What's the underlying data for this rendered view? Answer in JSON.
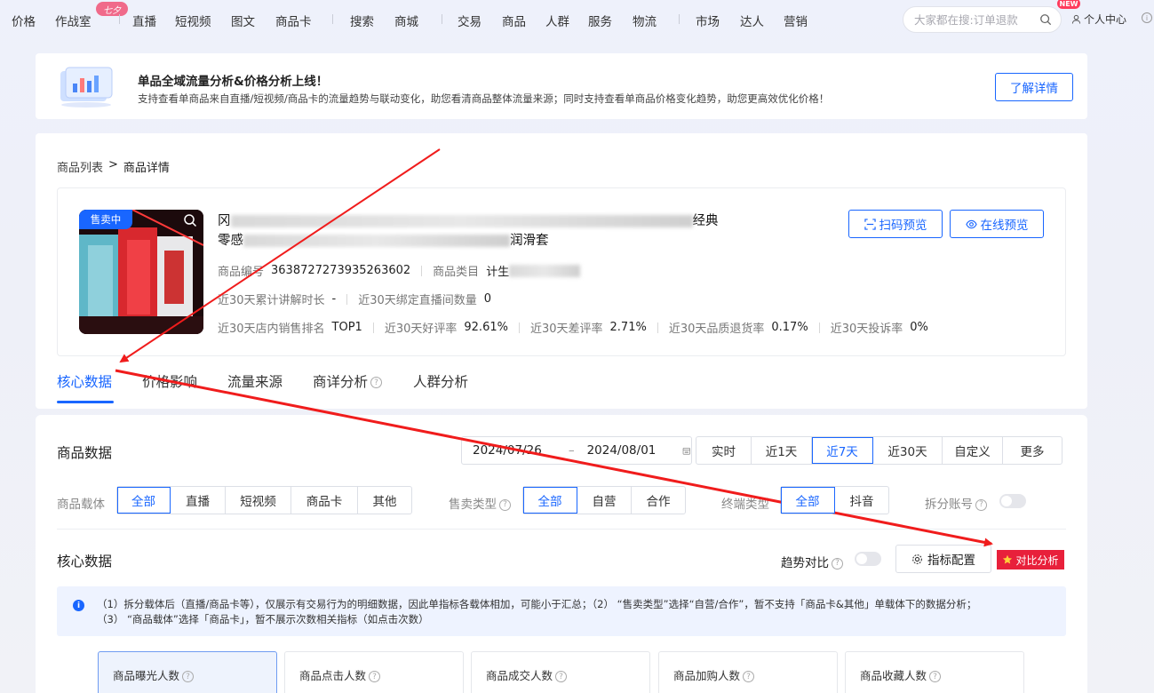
{
  "nav": {
    "items": [
      "价格",
      "作战室",
      "直播",
      "短视频",
      "图文",
      "商品卡",
      "搜索",
      "商城",
      "交易",
      "商品",
      "人群",
      "服务",
      "物流",
      "市场",
      "达人",
      "营销"
    ],
    "badge_7": "七夕",
    "search_placeholder": "大家都在搜:订单退款",
    "personal": "个人中心",
    "new_badge": "NEW"
  },
  "banner": {
    "title": "单品全域流量分析&价格分析上线！",
    "desc": "支持查看单商品来自直播/短视频/商品卡的流量趋势与联动变化，助您看清商品整体流量来源；同时支持查看单商品价格变化趋势，助您更高效优化价格！",
    "button": "了解详情"
  },
  "breadcrumb": {
    "list": "商品列表",
    "sep": ">",
    "current": "商品详情"
  },
  "product": {
    "status": "售卖中",
    "title_l1_start": "冈",
    "title_l1_end": "经典",
    "title_l2_start": "零感",
    "title_l2_end": "润滑套",
    "id_label": "商品编号",
    "id_value": "3638727273935263602",
    "category_label": "商品类目",
    "category_value": "计生",
    "explain_label": "近30天累计讲解时长",
    "explain_value": "-",
    "bind_label": "近30天绑定直播间数量",
    "bind_value": "0",
    "rank_label": "近30天店内销售排名",
    "rank_value": "TOP1",
    "good_label": "近30天好评率",
    "good_value": "92.61%",
    "bad_label": "近30天差评率",
    "bad_value": "2.71%",
    "refund_label": "近30天品质退货率",
    "refund_value": "0.17%",
    "complaint_label": "近30天投诉率",
    "complaint_value": "0%",
    "btn_scan": "扫码预览",
    "btn_online": "在线预览"
  },
  "tabs": [
    "核心数据",
    "价格影响",
    "流量来源",
    "商详分析",
    "人群分析"
  ],
  "goods_data": {
    "title": "商品数据",
    "date_start": "2024/07/26",
    "date_sep": "–",
    "date_end": "2024/08/01",
    "ranges": [
      "实时",
      "近1天",
      "近7天",
      "近30天",
      "自定义",
      "更多"
    ],
    "carrier_label": "商品载体",
    "carrier": [
      "全部",
      "直播",
      "短视频",
      "商品卡",
      "其他"
    ],
    "sale_label": "售卖类型",
    "sale": [
      "全部",
      "自营",
      "合作"
    ],
    "terminal_label": "终端类型",
    "terminal": [
      "全部",
      "抖音"
    ],
    "split_label": "拆分账号"
  },
  "core": {
    "title": "核心数据",
    "trend_label": "趋势对比",
    "config_btn": "指标配置",
    "compare_btn": "对比分析",
    "notice_l1": "（1）拆分载体后（直播/商品卡等），仅展示有交易行为的明细数据，因此单指标各载体相加，可能小于汇总；（2） “售卖类型”选择“自营/合作”，暂不支持「商品卡&其他」单载体下的数据分析；",
    "notice_l2": "（3） “商品载体”选择「商品卡」，暂不展示次数相关指标（如点击次数）",
    "metrics": [
      "商品曝光人数",
      "商品点击人数",
      "商品成交人数",
      "商品加购人数",
      "商品收藏人数"
    ]
  },
  "colors": {
    "accent": "#1966ff",
    "annotation": "#f01c1c",
    "compare": "#e8203b"
  }
}
